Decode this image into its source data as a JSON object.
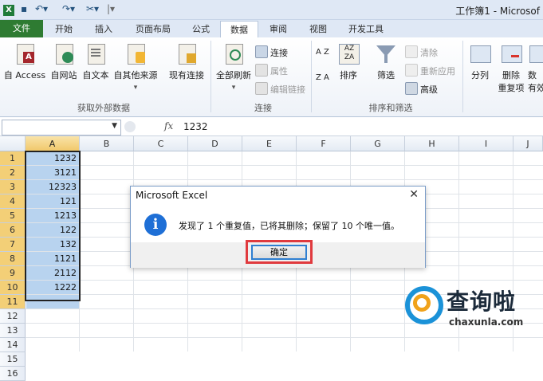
{
  "window": {
    "title": "工作簿1 - Microsof"
  },
  "tabs": [
    {
      "label": "文件"
    },
    {
      "label": "开始"
    },
    {
      "label": "插入"
    },
    {
      "label": "页面布局"
    },
    {
      "label": "公式"
    },
    {
      "label": "数据"
    },
    {
      "label": "审阅"
    },
    {
      "label": "视图"
    },
    {
      "label": "开发工具"
    }
  ],
  "ribbon": {
    "external": {
      "access": "自 Access",
      "web": "自网站",
      "text": "自文本",
      "other": "自其他来源",
      "existing": "现有连接",
      "group_label": "获取外部数据"
    },
    "connections": {
      "refresh_all": "全部刷新",
      "connections": "连接",
      "properties": "属性",
      "edit_links": "编辑链接",
      "group_label": "连接"
    },
    "sort_filter": {
      "sort": "排序",
      "filter": "筛选",
      "clear": "清除",
      "reapply": "重新应用",
      "advanced": "高级",
      "group_label": "排序和筛选",
      "az": "A Z",
      "za": "Z A"
    },
    "data_tools": {
      "split": "分列",
      "remove_dup": "删除",
      "remove_dup2": "重复项",
      "more": "数",
      "more2": "有效"
    }
  },
  "formula_bar": {
    "fx": "fx",
    "value": "1232"
  },
  "columns": [
    "A",
    "B",
    "C",
    "D",
    "E",
    "F",
    "G",
    "H",
    "I",
    "J"
  ],
  "rows": [
    "1",
    "2",
    "3",
    "4",
    "5",
    "6",
    "7",
    "8",
    "9",
    "10",
    "11",
    "12",
    "13",
    "14",
    "15",
    "16"
  ],
  "cells_a": [
    "1232",
    "3121",
    "12323",
    "121",
    "1213",
    "122",
    "132",
    "1121",
    "2112",
    "1222"
  ],
  "dialog": {
    "title": "Microsoft Excel",
    "close": "✕",
    "info": "i",
    "message": "发现了 1 个重复值，已将其删除；保留了 10 个唯一值。",
    "ok": "确定"
  },
  "watermark": {
    "title": "查询啦",
    "url": "chaxunla.com"
  },
  "colors": {
    "file_tab": "#2e7b32",
    "selection": "#b8d3ef",
    "highlight": "#e03a3e",
    "info": "#1e6fd6"
  }
}
